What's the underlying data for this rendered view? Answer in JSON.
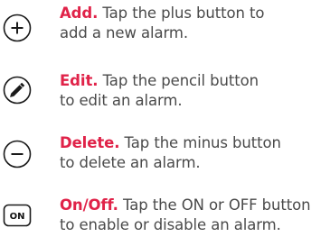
{
  "items": [
    {
      "icon": "plus-circle-icon",
      "title": "Add.",
      "line1": "Tap the plus button to",
      "line2": "add a new alarm."
    },
    {
      "icon": "pencil-circle-icon",
      "title": "Edit.",
      "line1": "Tap the pencil button",
      "line2": "to edit an alarm."
    },
    {
      "icon": "minus-circle-icon",
      "title": "Delete.",
      "line1": "Tap the minus button",
      "line2": "to delete an alarm."
    },
    {
      "icon": "on-button-icon",
      "icon_label": "ON",
      "title": "On/Off.",
      "line1": "Tap the ON or OFF button",
      "line2": "to enable or disable an alarm."
    }
  ],
  "colors": {
    "accent": "#e02349",
    "body_text": "#4a4a4a",
    "icon": "#1a1a1a"
  }
}
